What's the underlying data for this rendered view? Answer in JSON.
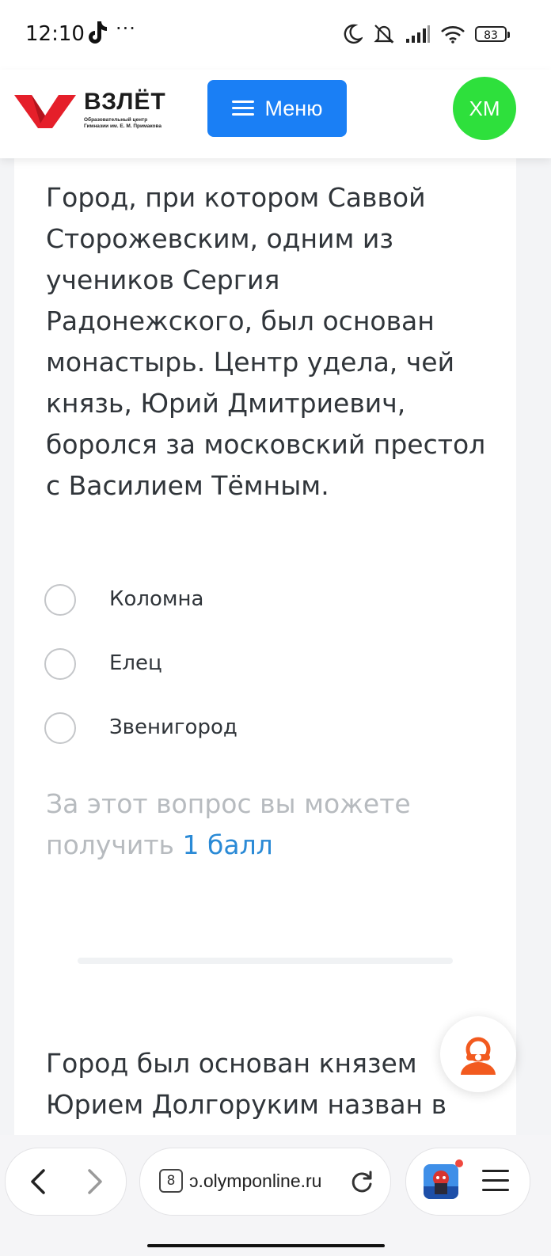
{
  "status_bar": {
    "time": "12:10",
    "more": "···",
    "battery": "83",
    "icons": [
      "tiktok-icon",
      "moon-icon",
      "bell-muted-icon",
      "signal-icon",
      "wifi-icon",
      "battery-icon"
    ]
  },
  "header": {
    "logo_title": "ВЗЛЁТ",
    "logo_subtitle_1": "Образовательный центр",
    "logo_subtitle_2": "Гимназии им. Е. М. Примакова",
    "menu_label": "Меню",
    "avatar_initials": "ХМ",
    "colors": {
      "menu": "#1a7ff5",
      "avatar": "#2ee03c",
      "logo_red": "#e51f2a"
    }
  },
  "question": {
    "text": "Город, при котором Саввой Сторожевским, одним из учеников Сергия Радонежского, был основан монастырь. Центр удела, чей князь, Юрий Дмитриевич, боролся за московский престол с Василием Тёмным.",
    "options": [
      {
        "label": "Коломна"
      },
      {
        "label": "Елец"
      },
      {
        "label": "Звенигород"
      }
    ],
    "points_prefix": "За этот вопрос вы можете получить",
    "points_value": "1 балл"
  },
  "next_question": {
    "text": "Город был основан князем Юрием Долгоруким назван в"
  },
  "browser": {
    "tab_count": "8",
    "url": "olymponline.ru",
    "url_visible": "ɔ.olymponline.ru"
  }
}
